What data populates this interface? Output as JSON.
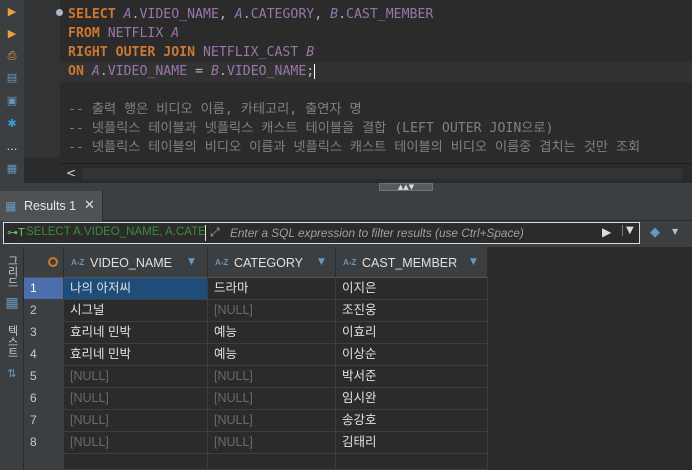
{
  "editor": {
    "lines": [
      {
        "parts": [
          [
            "kw",
            "SELECT "
          ],
          [
            "ali",
            "A"
          ],
          [
            "op",
            "."
          ],
          [
            "fld",
            "VIDEO_NAME"
          ],
          [
            "op",
            ", "
          ],
          [
            "ali",
            "A"
          ],
          [
            "op",
            "."
          ],
          [
            "fld",
            "CATEGORY"
          ],
          [
            "op",
            ", "
          ],
          [
            "ali",
            "B"
          ],
          [
            "op",
            "."
          ],
          [
            "fld",
            "CAST_MEMBER"
          ]
        ]
      },
      {
        "parts": [
          [
            "kw",
            "FROM "
          ],
          [
            "tbl",
            "NETFLIX "
          ],
          [
            "ali",
            "A"
          ]
        ]
      },
      {
        "parts": [
          [
            "kw",
            "RIGHT OUTER JOIN "
          ],
          [
            "tbl",
            "NETFLIX_CAST "
          ],
          [
            "ali",
            "B"
          ]
        ]
      },
      {
        "parts": [
          [
            "kw",
            "ON "
          ],
          [
            "ali",
            "A"
          ],
          [
            "op",
            "."
          ],
          [
            "fld",
            "VIDEO_NAME"
          ],
          [
            "op",
            " = "
          ],
          [
            "ali",
            "B"
          ],
          [
            "op",
            "."
          ],
          [
            "fld",
            "VIDEO_NAME"
          ],
          [
            "op",
            ";"
          ]
        ]
      },
      {
        "parts": [
          [
            "op",
            ""
          ]
        ]
      },
      {
        "parts": [
          [
            "cm",
            "-- 출력 행은 비디오 이름, 카테고리, 출연자 명"
          ]
        ]
      },
      {
        "parts": [
          [
            "cm",
            "-- 넷플릭스 테이블과 넷플릭스 캐스트 테이블을 결합 (LEFT OUTER JOIN으로)"
          ]
        ]
      },
      {
        "parts": [
          [
            "cm",
            "-- 넷플릭스 테이블의 비디오 이름과 넷플릭스 캐스트 테이블의 비디오 이름중 겹치는 것만 조회"
          ]
        ]
      }
    ],
    "scroll_left_glyph": "<"
  },
  "results_tab": {
    "label": "Results 1",
    "close": "✕"
  },
  "filter": {
    "current": "SELECT A.VIDEO_NAME, A.CATE",
    "placeholder": "Enter a SQL expression to filter results (use Ctrl+Space)"
  },
  "side_tabs": [
    "그리드",
    "텍스트"
  ],
  "grid": {
    "columns": [
      "VIDEO_NAME",
      "CATEGORY",
      "CAST_MEMBER"
    ],
    "rows": [
      {
        "num": "1",
        "cells": [
          "나의 아저씨",
          "드라마",
          "이지은"
        ]
      },
      {
        "num": "2",
        "cells": [
          "시그널",
          "[NULL]",
          "조진웅"
        ]
      },
      {
        "num": "3",
        "cells": [
          "효리네 민박",
          "예능",
          "이효리"
        ]
      },
      {
        "num": "4",
        "cells": [
          "효리네 민박",
          "예능",
          "이상순"
        ]
      },
      {
        "num": "5",
        "cells": [
          "[NULL]",
          "[NULL]",
          "박서준"
        ]
      },
      {
        "num": "6",
        "cells": [
          "[NULL]",
          "[NULL]",
          "임시완"
        ]
      },
      {
        "num": "7",
        "cells": [
          "[NULL]",
          "[NULL]",
          "송강호"
        ]
      },
      {
        "num": "8",
        "cells": [
          "[NULL]",
          "[NULL]",
          "김태리"
        ]
      }
    ],
    "selected_row": 0,
    "null_text": "[NULL]"
  },
  "colors": {
    "keyword": "#cc7832",
    "alias": "#9876aa",
    "comment": "#808080",
    "selection": "#1f4d7a"
  }
}
